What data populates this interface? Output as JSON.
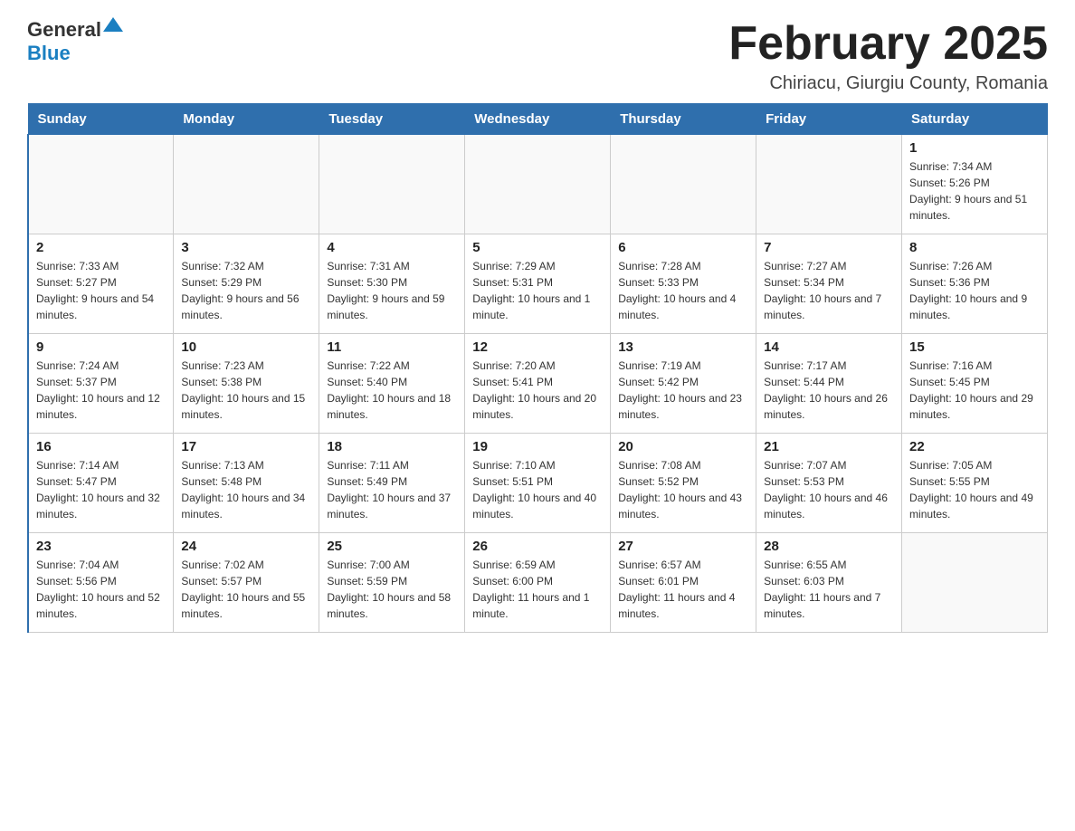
{
  "header": {
    "logo_general": "General",
    "logo_blue": "Blue",
    "title": "February 2025",
    "subtitle": "Chiriacu, Giurgiu County, Romania"
  },
  "weekdays": [
    "Sunday",
    "Monday",
    "Tuesday",
    "Wednesday",
    "Thursday",
    "Friday",
    "Saturday"
  ],
  "weeks": [
    [
      {
        "day": "",
        "info": ""
      },
      {
        "day": "",
        "info": ""
      },
      {
        "day": "",
        "info": ""
      },
      {
        "day": "",
        "info": ""
      },
      {
        "day": "",
        "info": ""
      },
      {
        "day": "",
        "info": ""
      },
      {
        "day": "1",
        "info": "Sunrise: 7:34 AM\nSunset: 5:26 PM\nDaylight: 9 hours and 51 minutes."
      }
    ],
    [
      {
        "day": "2",
        "info": "Sunrise: 7:33 AM\nSunset: 5:27 PM\nDaylight: 9 hours and 54 minutes."
      },
      {
        "day": "3",
        "info": "Sunrise: 7:32 AM\nSunset: 5:29 PM\nDaylight: 9 hours and 56 minutes."
      },
      {
        "day": "4",
        "info": "Sunrise: 7:31 AM\nSunset: 5:30 PM\nDaylight: 9 hours and 59 minutes."
      },
      {
        "day": "5",
        "info": "Sunrise: 7:29 AM\nSunset: 5:31 PM\nDaylight: 10 hours and 1 minute."
      },
      {
        "day": "6",
        "info": "Sunrise: 7:28 AM\nSunset: 5:33 PM\nDaylight: 10 hours and 4 minutes."
      },
      {
        "day": "7",
        "info": "Sunrise: 7:27 AM\nSunset: 5:34 PM\nDaylight: 10 hours and 7 minutes."
      },
      {
        "day": "8",
        "info": "Sunrise: 7:26 AM\nSunset: 5:36 PM\nDaylight: 10 hours and 9 minutes."
      }
    ],
    [
      {
        "day": "9",
        "info": "Sunrise: 7:24 AM\nSunset: 5:37 PM\nDaylight: 10 hours and 12 minutes."
      },
      {
        "day": "10",
        "info": "Sunrise: 7:23 AM\nSunset: 5:38 PM\nDaylight: 10 hours and 15 minutes."
      },
      {
        "day": "11",
        "info": "Sunrise: 7:22 AM\nSunset: 5:40 PM\nDaylight: 10 hours and 18 minutes."
      },
      {
        "day": "12",
        "info": "Sunrise: 7:20 AM\nSunset: 5:41 PM\nDaylight: 10 hours and 20 minutes."
      },
      {
        "day": "13",
        "info": "Sunrise: 7:19 AM\nSunset: 5:42 PM\nDaylight: 10 hours and 23 minutes."
      },
      {
        "day": "14",
        "info": "Sunrise: 7:17 AM\nSunset: 5:44 PM\nDaylight: 10 hours and 26 minutes."
      },
      {
        "day": "15",
        "info": "Sunrise: 7:16 AM\nSunset: 5:45 PM\nDaylight: 10 hours and 29 minutes."
      }
    ],
    [
      {
        "day": "16",
        "info": "Sunrise: 7:14 AM\nSunset: 5:47 PM\nDaylight: 10 hours and 32 minutes."
      },
      {
        "day": "17",
        "info": "Sunrise: 7:13 AM\nSunset: 5:48 PM\nDaylight: 10 hours and 34 minutes."
      },
      {
        "day": "18",
        "info": "Sunrise: 7:11 AM\nSunset: 5:49 PM\nDaylight: 10 hours and 37 minutes."
      },
      {
        "day": "19",
        "info": "Sunrise: 7:10 AM\nSunset: 5:51 PM\nDaylight: 10 hours and 40 minutes."
      },
      {
        "day": "20",
        "info": "Sunrise: 7:08 AM\nSunset: 5:52 PM\nDaylight: 10 hours and 43 minutes."
      },
      {
        "day": "21",
        "info": "Sunrise: 7:07 AM\nSunset: 5:53 PM\nDaylight: 10 hours and 46 minutes."
      },
      {
        "day": "22",
        "info": "Sunrise: 7:05 AM\nSunset: 5:55 PM\nDaylight: 10 hours and 49 minutes."
      }
    ],
    [
      {
        "day": "23",
        "info": "Sunrise: 7:04 AM\nSunset: 5:56 PM\nDaylight: 10 hours and 52 minutes."
      },
      {
        "day": "24",
        "info": "Sunrise: 7:02 AM\nSunset: 5:57 PM\nDaylight: 10 hours and 55 minutes."
      },
      {
        "day": "25",
        "info": "Sunrise: 7:00 AM\nSunset: 5:59 PM\nDaylight: 10 hours and 58 minutes."
      },
      {
        "day": "26",
        "info": "Sunrise: 6:59 AM\nSunset: 6:00 PM\nDaylight: 11 hours and 1 minute."
      },
      {
        "day": "27",
        "info": "Sunrise: 6:57 AM\nSunset: 6:01 PM\nDaylight: 11 hours and 4 minutes."
      },
      {
        "day": "28",
        "info": "Sunrise: 6:55 AM\nSunset: 6:03 PM\nDaylight: 11 hours and 7 minutes."
      },
      {
        "day": "",
        "info": ""
      }
    ]
  ]
}
